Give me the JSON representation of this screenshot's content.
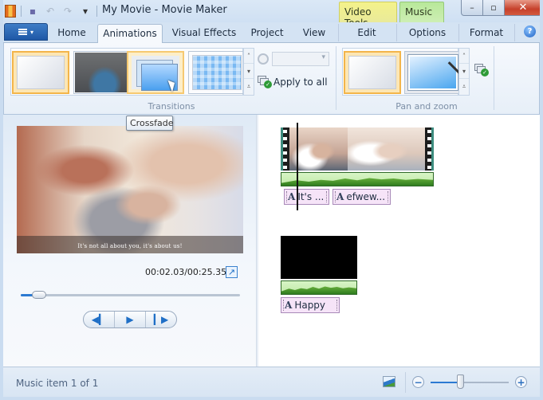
{
  "window": {
    "title": "My Movie - Movie Maker",
    "contextual_tabs": [
      "Video Tools",
      "Music ..."
    ],
    "controls": {
      "minimize": "–",
      "maximize": "▫",
      "close": "✕"
    }
  },
  "quick_access": {
    "icons": [
      "app-icon",
      "save-icon",
      "undo-icon",
      "redo-icon",
      "customize-dropdown-icon"
    ],
    "glyphs": {
      "save": "▪",
      "undo": "↶",
      "redo": "↷",
      "customize": "▾"
    }
  },
  "ribbon_tabs": {
    "file_menu_caret": "▾",
    "items": [
      {
        "label": "Home",
        "active": false
      },
      {
        "label": "Animations",
        "active": true
      },
      {
        "label": "Visual Effects",
        "active": false
      },
      {
        "label": "Project",
        "active": false
      },
      {
        "label": "View",
        "active": false
      },
      {
        "label": "Edit",
        "active": false,
        "context": "Video Tools"
      },
      {
        "label": "Options",
        "active": false,
        "context": "Music ..."
      },
      {
        "label": "Format",
        "active": false
      }
    ],
    "help_glyph": "?"
  },
  "transitions": {
    "group_label": "Transitions",
    "items": [
      {
        "name": "No transition",
        "state": "selected"
      },
      {
        "name": "Fade",
        "state": "normal"
      },
      {
        "name": "Crossfade",
        "state": "hover"
      },
      {
        "name": "Mosaic",
        "state": "normal"
      }
    ],
    "scroll_glyphs": [
      "˄",
      "▾",
      "⩡"
    ],
    "duration_value": "",
    "apply_to_all_label": "Apply to all",
    "tooltip": "Crossfade"
  },
  "pan_zoom": {
    "group_label": "Pan and zoom",
    "items": [
      {
        "name": "No pan and zoom",
        "state": "selected"
      },
      {
        "name": "Automatic",
        "state": "normal"
      }
    ],
    "scroll_glyphs": [
      "˄",
      "▾",
      "⩡"
    ]
  },
  "preview": {
    "caption_text": "It's not all about you, it's about us!",
    "timecode": "00:02.03/00:25.35",
    "position_fraction": 0.08,
    "fullscreen_glyph": "↗",
    "transport": {
      "previous": "◀▎",
      "play": "▶",
      "next": "▎▶"
    }
  },
  "storyboard": {
    "captions": [
      {
        "icon": "A",
        "label": "It's ..."
      },
      {
        "icon": "A",
        "label": "efwew..."
      },
      {
        "icon": "A",
        "label": "Happy"
      }
    ]
  },
  "statusbar": {
    "status_text": "Music item 1 of 1",
    "zoom_out": "−",
    "zoom_in": "+",
    "zoom_fraction": 0.38
  }
}
